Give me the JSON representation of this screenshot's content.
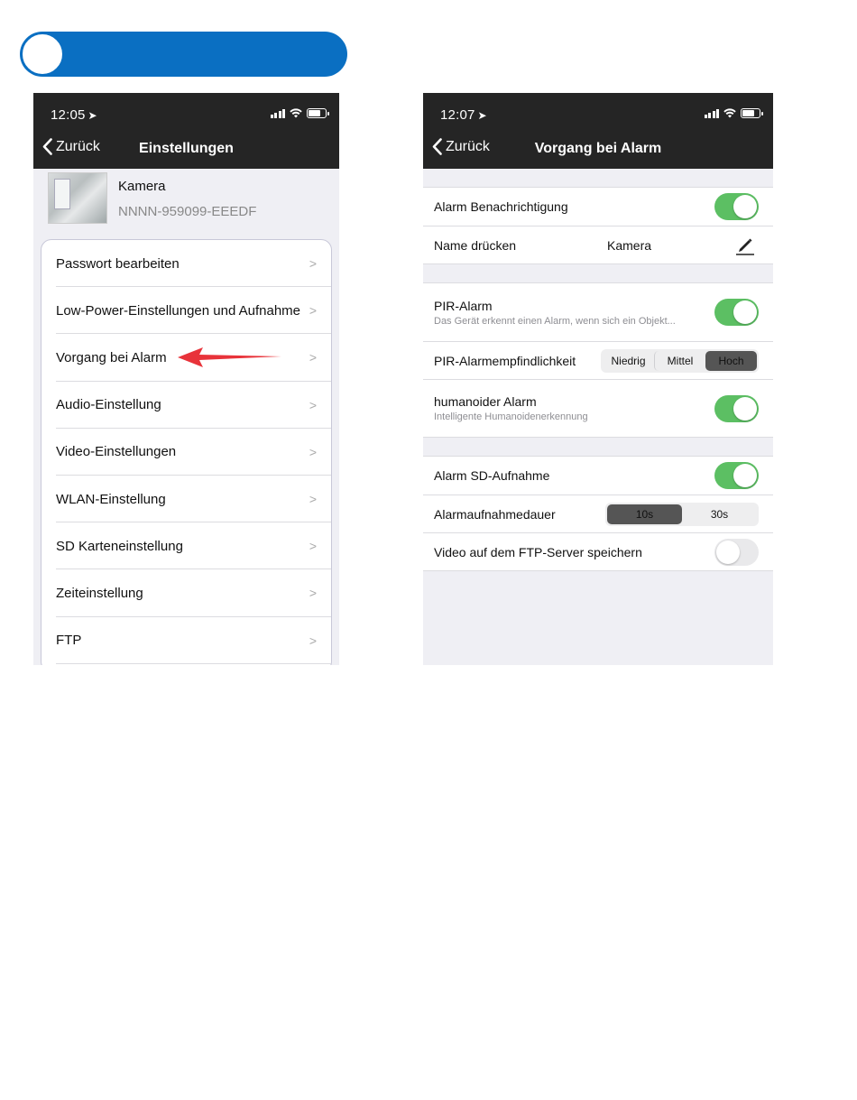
{
  "left": {
    "status": {
      "time": "12:05"
    },
    "nav": {
      "back": "Zurück",
      "title": "Einstellungen"
    },
    "camera": {
      "name": "Kamera",
      "id": "NNNN-959099-EEEDF"
    },
    "menu": [
      "Passwort bearbeiten",
      "Low-Power-Einstellungen und Aufnahme",
      "Vorgang bei Alarm",
      "Audio-Einstellung",
      "Video-Einstellungen",
      "WLAN-Einstellung",
      "SD Karteneinstellung",
      "Zeiteinstellung",
      "FTP"
    ]
  },
  "right": {
    "status": {
      "time": "12:07"
    },
    "nav": {
      "back": "Zurück",
      "title": "Vorgang bei Alarm"
    },
    "alarm_notification": {
      "label": "Alarm Benachrichtigung",
      "on": true
    },
    "name_press": {
      "label": "Name drücken",
      "value": "Kamera"
    },
    "pir_alarm": {
      "label": "PIR-Alarm",
      "sub": "Das Gerät erkennt einen Alarm, wenn sich ein Objekt...",
      "on": true
    },
    "pir_sensitivity": {
      "label": "PIR-Alarmempfindlichkeit",
      "options": [
        "Niedrig",
        "Mittel",
        "Hoch"
      ],
      "selected": "Hoch"
    },
    "humanoid_alarm": {
      "label": "humanoider Alarm",
      "sub": "Intelligente Humanoidenerkennung",
      "on": true
    },
    "sd_recording": {
      "label": "Alarm SD-Aufnahme",
      "on": true
    },
    "duration": {
      "label": "Alarmaufnahmedauer",
      "options": [
        "10s",
        "30s"
      ],
      "selected": "10s"
    },
    "ftp_save": {
      "label": "Video auf dem FTP-Server speichern",
      "on": false
    }
  },
  "colors": {
    "banner": "#0a6fc2",
    "topbar": "#252525",
    "toggle_on": "#5cbf63",
    "arrow": "#e8333a"
  }
}
